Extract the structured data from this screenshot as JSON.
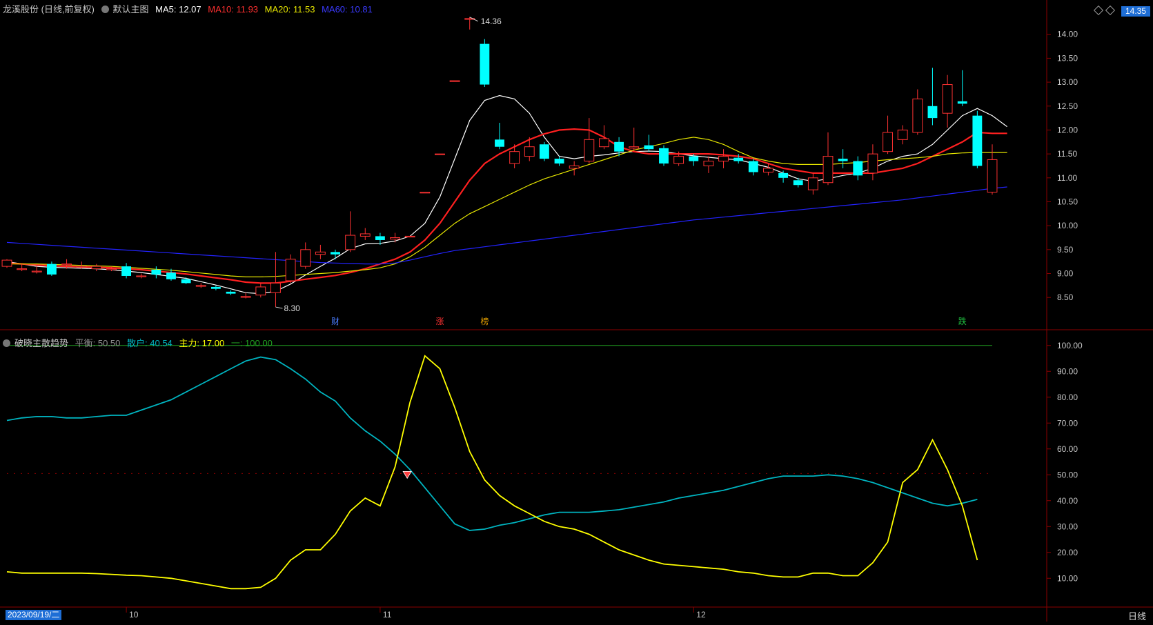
{
  "header_main": {
    "stock": "龙溪股份 (日线,前复权)",
    "template": "默认主图",
    "ma5": "MA5: 12.07",
    "ma10": "MA10: 11.93",
    "ma20": "MA20: 11.53",
    "ma60": "MA60: 10.81"
  },
  "current_price_tag": "14.35",
  "header_ind": {
    "name": "破晓主散趋势",
    "balance": "平衡: 50.50",
    "retail": "散户: 40.54",
    "main": "主力: 17.00",
    "line": "一: 100.00"
  },
  "date_tag": "2023/09/19/二",
  "period": "日线",
  "colors": {
    "up": "#ff3232",
    "down": "#00ffff",
    "ma5": "#ffffff",
    "ma10": "#ff2020",
    "ma20": "#e6e600",
    "ma60": "#2323ff",
    "retail": "#00b4c0",
    "main": "#ffff00",
    "line": "#20a020",
    "axis": "#8b0000"
  },
  "chart_data": [
    {
      "type": "candlestick",
      "title": "龙溪股份 (日线,前复权)",
      "ylim": [
        8.2,
        14.4
      ],
      "y_ticks": [
        8.5,
        9.0,
        9.5,
        10.0,
        10.5,
        11.0,
        11.5,
        12.0,
        12.5,
        13.0,
        13.5,
        14.0
      ],
      "annotations": {
        "high": "14.36",
        "low": "8.30",
        "markers": [
          "财",
          "涨",
          "榜",
          "跌"
        ],
        "marker_index": [
          22,
          29,
          32,
          64
        ]
      },
      "x_labels": [
        "10",
        "11",
        "12"
      ],
      "x_label_index": [
        8,
        25,
        46
      ],
      "candles": [
        [
          9.15,
          9.28,
          9.3,
          9.12
        ],
        [
          9.1,
          9.1,
          9.2,
          9.05
        ],
        [
          9.05,
          9.05,
          9.15,
          9.0
        ],
        [
          9.2,
          8.98,
          9.25,
          8.95
        ],
        [
          9.2,
          9.2,
          9.3,
          9.1
        ],
        [
          9.15,
          9.15,
          9.25,
          9.1
        ],
        [
          9.1,
          9.15,
          9.2,
          9.05
        ],
        [
          9.08,
          9.1,
          9.15,
          9.05
        ],
        [
          9.15,
          8.95,
          9.22,
          8.9
        ],
        [
          8.95,
          8.95,
          9.0,
          8.9
        ],
        [
          9.08,
          8.98,
          9.15,
          8.9
        ],
        [
          9.02,
          8.88,
          9.1,
          8.85
        ],
        [
          8.88,
          8.8,
          8.92,
          8.78
        ],
        [
          8.75,
          8.75,
          8.8,
          8.7
        ],
        [
          8.72,
          8.68,
          8.75,
          8.65
        ],
        [
          8.62,
          8.58,
          8.65,
          8.55
        ],
        [
          8.52,
          8.52,
          8.6,
          8.48
        ],
        [
          8.55,
          8.72,
          8.8,
          8.5
        ],
        [
          8.6,
          8.8,
          9.45,
          8.3
        ],
        [
          8.85,
          9.3,
          9.4,
          8.8
        ],
        [
          9.15,
          9.5,
          9.65,
          9.1
        ],
        [
          9.4,
          9.45,
          9.6,
          9.3
        ],
        [
          9.45,
          9.4,
          9.5,
          9.3
        ],
        [
          9.5,
          9.8,
          10.3,
          9.45
        ],
        [
          9.78,
          9.83,
          9.95,
          9.7
        ],
        [
          9.78,
          9.7,
          9.85,
          9.6
        ],
        [
          9.72,
          9.75,
          9.85,
          9.65
        ],
        [
          9.78,
          9.78,
          9.78,
          9.78
        ],
        [
          10.7,
          10.7,
          10.7,
          10.7
        ],
        [
          11.5,
          11.5,
          11.5,
          11.5
        ],
        [
          13.03,
          13.03,
          13.03,
          13.03
        ],
        [
          14.33,
          14.33,
          14.36,
          14.1
        ],
        [
          13.8,
          12.95,
          13.9,
          12.9
        ],
        [
          11.8,
          11.65,
          12.15,
          11.6
        ],
        [
          11.3,
          11.55,
          11.7,
          11.2
        ],
        [
          11.45,
          11.65,
          11.85,
          11.35
        ],
        [
          11.7,
          11.4,
          11.75,
          11.35
        ],
        [
          11.4,
          11.3,
          11.45,
          11.25
        ],
        [
          11.2,
          11.25,
          11.35,
          11.05
        ],
        [
          11.35,
          11.8,
          12.25,
          11.3
        ],
        [
          11.65,
          11.82,
          12.1,
          11.6
        ],
        [
          11.75,
          11.55,
          11.85,
          11.45
        ],
        [
          11.62,
          11.65,
          12.05,
          11.55
        ],
        [
          11.68,
          11.6,
          11.9,
          11.55
        ],
        [
          11.62,
          11.3,
          11.68,
          11.25
        ],
        [
          11.3,
          11.45,
          11.55,
          11.25
        ],
        [
          11.45,
          11.35,
          11.5,
          11.25
        ],
        [
          11.25,
          11.35,
          11.45,
          11.1
        ],
        [
          11.35,
          11.45,
          11.6,
          11.2
        ],
        [
          11.42,
          11.35,
          11.5,
          11.3
        ],
        [
          11.35,
          11.12,
          11.4,
          11.05
        ],
        [
          11.12,
          11.2,
          11.3,
          11.05
        ],
        [
          11.1,
          11.0,
          11.15,
          10.9
        ],
        [
          10.95,
          10.85,
          11.0,
          10.8
        ],
        [
          10.75,
          11.0,
          11.1,
          10.65
        ],
        [
          10.9,
          11.45,
          11.95,
          10.85
        ],
        [
          11.4,
          11.35,
          11.6,
          11.2
        ],
        [
          11.35,
          11.05,
          11.45,
          10.95
        ],
        [
          11.1,
          11.5,
          11.7,
          10.95
        ],
        [
          11.55,
          11.95,
          12.3,
          11.5
        ],
        [
          11.8,
          12.0,
          12.1,
          11.7
        ],
        [
          11.95,
          12.65,
          12.85,
          11.9
        ],
        [
          12.5,
          12.25,
          13.3,
          12.1
        ],
        [
          12.35,
          12.95,
          13.15,
          12.05
        ],
        [
          12.6,
          12.55,
          13.25,
          12.5
        ],
        [
          12.3,
          11.25,
          12.4,
          11.2
        ],
        [
          10.7,
          11.38,
          11.7,
          10.65
        ]
      ],
      "series": [
        {
          "name": "MA5",
          "values": [
            9.25,
            9.2,
            9.15,
            9.13,
            9.12,
            9.11,
            9.1,
            9.08,
            9.05,
            9.02,
            8.98,
            8.94,
            8.9,
            8.83,
            8.76,
            8.68,
            8.6,
            8.58,
            8.63,
            8.78,
            8.97,
            9.15,
            9.32,
            9.52,
            9.62,
            9.63,
            9.68,
            9.78,
            10.05,
            10.6,
            11.4,
            12.2,
            12.62,
            12.72,
            12.65,
            12.35,
            11.85,
            11.45,
            11.4,
            11.45,
            11.48,
            11.52,
            11.55,
            11.56,
            11.55,
            11.5,
            11.46,
            11.43,
            11.4,
            11.38,
            11.3,
            11.22,
            11.1,
            10.98,
            10.93,
            10.98,
            11.05,
            11.1,
            11.2,
            11.35,
            11.45,
            11.5,
            11.7,
            12.0,
            12.3,
            12.45,
            12.3,
            12.07
          ]
        },
        {
          "name": "MA10",
          "values": [
            9.22,
            9.2,
            9.18,
            9.16,
            9.15,
            9.14,
            9.13,
            9.12,
            9.1,
            9.08,
            9.05,
            9.02,
            8.99,
            8.95,
            8.91,
            8.87,
            8.82,
            8.8,
            8.8,
            8.84,
            8.88,
            8.92,
            8.96,
            9.02,
            9.1,
            9.2,
            9.3,
            9.45,
            9.7,
            10.05,
            10.5,
            10.95,
            11.3,
            11.5,
            11.65,
            11.8,
            11.92,
            12.0,
            12.02,
            12.0,
            11.85,
            11.65,
            11.55,
            11.5,
            11.5,
            11.5,
            11.5,
            11.5,
            11.48,
            11.45,
            11.4,
            11.3,
            11.2,
            11.15,
            11.1,
            11.1,
            11.1,
            11.1,
            11.1,
            11.15,
            11.2,
            11.3,
            11.45,
            11.6,
            11.75,
            11.95,
            11.93,
            11.93
          ]
        },
        {
          "name": "MA20",
          "values": [
            9.2,
            9.2,
            9.2,
            9.19,
            9.18,
            9.17,
            9.16,
            9.15,
            9.13,
            9.11,
            9.09,
            9.07,
            9.04,
            9.01,
            8.98,
            8.95,
            8.93,
            8.93,
            8.94,
            8.96,
            8.98,
            9.0,
            9.02,
            9.05,
            9.08,
            9.12,
            9.2,
            9.35,
            9.55,
            9.8,
            10.05,
            10.25,
            10.4,
            10.55,
            10.7,
            10.85,
            10.98,
            11.08,
            11.18,
            11.28,
            11.38,
            11.48,
            11.58,
            11.65,
            11.72,
            11.8,
            11.85,
            11.8,
            11.7,
            11.55,
            11.42,
            11.35,
            11.3,
            11.28,
            11.28,
            11.28,
            11.3,
            11.32,
            11.35,
            11.38,
            11.4,
            11.42,
            11.45,
            11.5,
            11.52,
            11.53,
            11.53,
            11.53
          ]
        },
        {
          "name": "MA60",
          "values": [
            9.65,
            9.63,
            9.61,
            9.59,
            9.57,
            9.55,
            9.53,
            9.51,
            9.49,
            9.47,
            9.45,
            9.43,
            9.41,
            9.39,
            9.37,
            9.35,
            9.33,
            9.31,
            9.29,
            9.27,
            9.25,
            9.23,
            9.22,
            9.21,
            9.2,
            9.2,
            9.22,
            9.28,
            9.35,
            9.42,
            9.48,
            9.52,
            9.56,
            9.6,
            9.64,
            9.68,
            9.72,
            9.76,
            9.8,
            9.84,
            9.88,
            9.92,
            9.96,
            10.0,
            10.04,
            10.08,
            10.12,
            10.15,
            10.18,
            10.21,
            10.24,
            10.27,
            10.3,
            10.33,
            10.36,
            10.39,
            10.42,
            10.45,
            10.48,
            10.51,
            10.54,
            10.58,
            10.62,
            10.66,
            10.7,
            10.74,
            10.78,
            10.81
          ]
        }
      ]
    },
    {
      "type": "line",
      "title": "破晓主散趋势",
      "ylim": [
        5,
        105
      ],
      "y_ticks": [
        10.0,
        20.0,
        30.0,
        40.0,
        50.0,
        60.0,
        70.0,
        80.0,
        90.0,
        100.0
      ],
      "balance": 50.5,
      "signal_index": 27,
      "series": [
        {
          "name": "散户",
          "values": [
            71,
            72,
            72.5,
            72.5,
            72,
            72,
            72.5,
            73,
            73,
            75,
            77,
            79,
            82,
            85,
            88,
            91,
            94,
            95.5,
            94.5,
            91,
            87,
            82,
            78.5,
            72,
            67,
            63,
            58,
            52,
            45,
            38,
            31,
            28.5,
            29,
            30.5,
            31.5,
            33,
            34.5,
            35.5,
            35.5,
            35.5,
            36,
            36.5,
            37.5,
            38.5,
            39.5,
            41,
            42,
            43,
            44,
            45.5,
            47,
            48.5,
            49.5,
            49.5,
            49.5,
            50,
            49.5,
            48.5,
            47,
            45,
            43,
            41,
            39,
            38,
            39,
            40.5
          ]
        },
        {
          "name": "主力",
          "values": [
            12.5,
            12,
            12,
            12,
            12,
            12,
            11.8,
            11.5,
            11.2,
            11,
            10.5,
            10,
            9,
            8,
            7,
            6,
            6,
            6.5,
            10,
            17,
            21,
            21,
            27,
            36,
            41,
            38,
            53,
            78,
            96,
            91,
            76,
            59,
            48,
            42,
            38,
            35,
            32,
            30,
            29,
            27,
            24,
            21,
            19,
            17,
            15.5,
            15,
            14.5,
            14,
            13.5,
            12.5,
            12,
            11,
            10.5,
            10.5,
            12,
            12,
            11,
            11,
            16,
            24,
            47,
            52,
            63.5,
            52,
            38,
            17
          ]
        },
        {
          "name": "一",
          "values": [
            100
          ]
        }
      ]
    }
  ]
}
